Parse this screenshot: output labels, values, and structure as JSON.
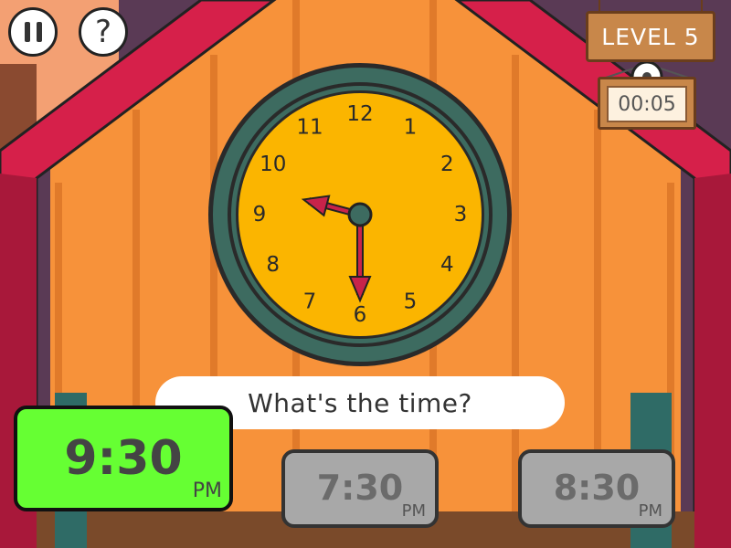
{
  "hud": {
    "pause_icon": "pause-icon",
    "help_icon": "question-mark-icon",
    "help_symbol": "?",
    "level_label": "LEVEL 5",
    "timer": "00:05"
  },
  "clock": {
    "numbers": [
      "12",
      "1",
      "2",
      "3",
      "4",
      "5",
      "6",
      "7",
      "8",
      "9",
      "10",
      "11"
    ],
    "hour_hand_value": 9.5,
    "minute_hand_value": 30,
    "face_color": "#fbb500",
    "rim_color": "#3d6b60",
    "hand_color": "#c8234a"
  },
  "question": "What's the time?",
  "answers": [
    {
      "time": "9:30",
      "period": "PM",
      "state": "selected",
      "color": "#66ff33"
    },
    {
      "time": "7:30",
      "period": "PM",
      "state": "disabled",
      "color": "#a8a8a8"
    },
    {
      "time": "8:30",
      "period": "PM",
      "state": "disabled",
      "color": "#a8a8a8"
    }
  ],
  "colors": {
    "wall": "#f7923a",
    "roof": "#d6204a",
    "background": "#5a3a55"
  }
}
